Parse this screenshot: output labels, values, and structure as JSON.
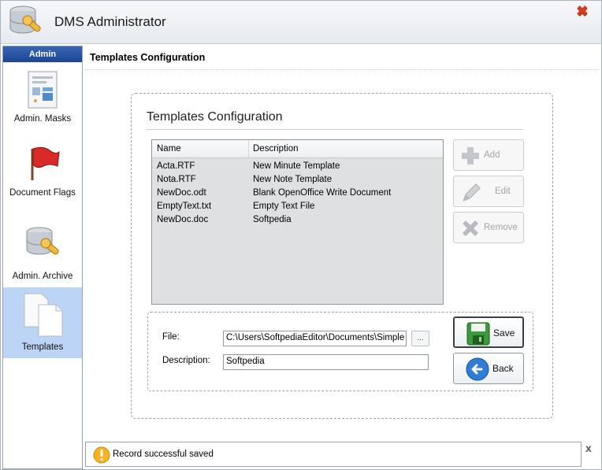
{
  "window": {
    "title": "DMS Administrator"
  },
  "sidebar": {
    "header": "Admin",
    "items": [
      {
        "label": "Admin. Masks",
        "icon": "form-document-icon",
        "active": false
      },
      {
        "label": "Document Flags",
        "icon": "red-flag-icon",
        "active": false
      },
      {
        "label": "Admin. Archive",
        "icon": "database-wrench-icon",
        "active": false
      },
      {
        "label": "Templates",
        "icon": "templates-pages-icon",
        "active": true
      }
    ]
  },
  "content": {
    "title": "Templates Configuration"
  },
  "panel": {
    "title": "Templates Configuration",
    "list": {
      "columns": [
        "Name",
        "Description"
      ],
      "rows": [
        {
          "name": "Acta.RTF",
          "description": "New Minute Template"
        },
        {
          "name": "Nota.RTF",
          "description": "New Note Template"
        },
        {
          "name": "NewDoc.odt",
          "description": "Blank OpenOffice Write Document"
        },
        {
          "name": "EmptyText.txt",
          "description": "Empty Text File"
        },
        {
          "name": "NewDoc.doc",
          "description": "Softpedia"
        }
      ]
    },
    "actions": {
      "add": "Add",
      "edit": "Edit",
      "remove": "Remove"
    },
    "form": {
      "file_label": "File:",
      "file_value": "C:\\Users\\SoftpediaEditor\\Documents\\Simple Do",
      "browse_label": "...",
      "description_label": "Description:",
      "description_value": "Softpedia",
      "save_label": "Save",
      "back_label": "Back"
    }
  },
  "status": {
    "message": "Record successful saved",
    "close": "x"
  },
  "colors": {
    "accent": "#1c4592",
    "active_nav": "#bcd4f6"
  }
}
